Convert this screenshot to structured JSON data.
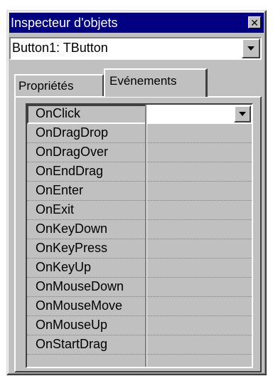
{
  "window": {
    "title": "Inspecteur d'objets",
    "close_icon": "close-icon"
  },
  "object_selector": {
    "value": "Button1: TButton",
    "dropdown_icon": "chevron-down-icon"
  },
  "tabs": [
    {
      "label": "Propriétés",
      "active": false
    },
    {
      "label": "Evénements",
      "active": true
    }
  ],
  "events": [
    {
      "name": "OnClick",
      "value": "",
      "selected": true
    },
    {
      "name": "OnDragDrop",
      "value": ""
    },
    {
      "name": "OnDragOver",
      "value": ""
    },
    {
      "name": "OnEndDrag",
      "value": ""
    },
    {
      "name": "OnEnter",
      "value": ""
    },
    {
      "name": "OnExit",
      "value": ""
    },
    {
      "name": "OnKeyDown",
      "value": ""
    },
    {
      "name": "OnKeyPress",
      "value": ""
    },
    {
      "name": "OnKeyUp",
      "value": ""
    },
    {
      "name": "OnMouseDown",
      "value": ""
    },
    {
      "name": "OnMouseMove",
      "value": ""
    },
    {
      "name": "OnMouseUp",
      "value": ""
    },
    {
      "name": "OnStartDrag",
      "value": ""
    }
  ],
  "colors": {
    "titlebar": "#000080",
    "face": "#c0c0c0",
    "value_bg": "#ffffff"
  }
}
